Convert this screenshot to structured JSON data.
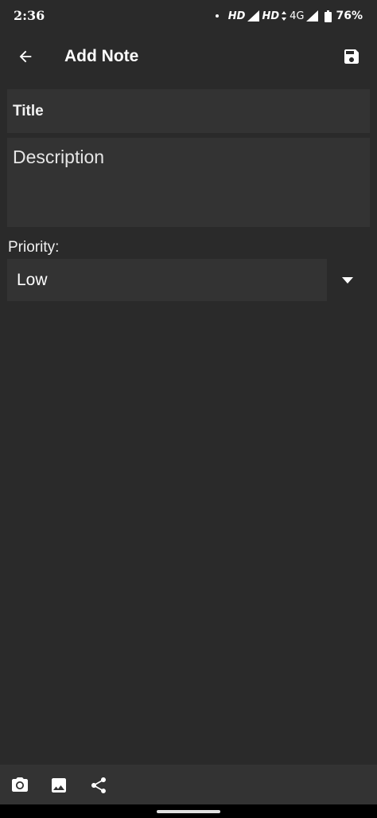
{
  "status_bar": {
    "time": "2:36",
    "network_1": "HD",
    "network_2": "HD",
    "network_type": "4G",
    "battery": "76%"
  },
  "app_bar": {
    "title": "Add Note",
    "back_icon": "arrow-left-icon",
    "save_icon": "floppy-disk-icon"
  },
  "form": {
    "title_placeholder": "Title",
    "title_value": "",
    "description_placeholder": "Description",
    "description_value": "",
    "priority_label": "Priority:",
    "priority_selected": "Low"
  },
  "toolbar": {
    "icons": [
      "camera-icon",
      "image-icon",
      "share-icon"
    ]
  },
  "colors": {
    "background": "#2a2a2a",
    "field_background": "#333333",
    "text": "#ffffff"
  }
}
